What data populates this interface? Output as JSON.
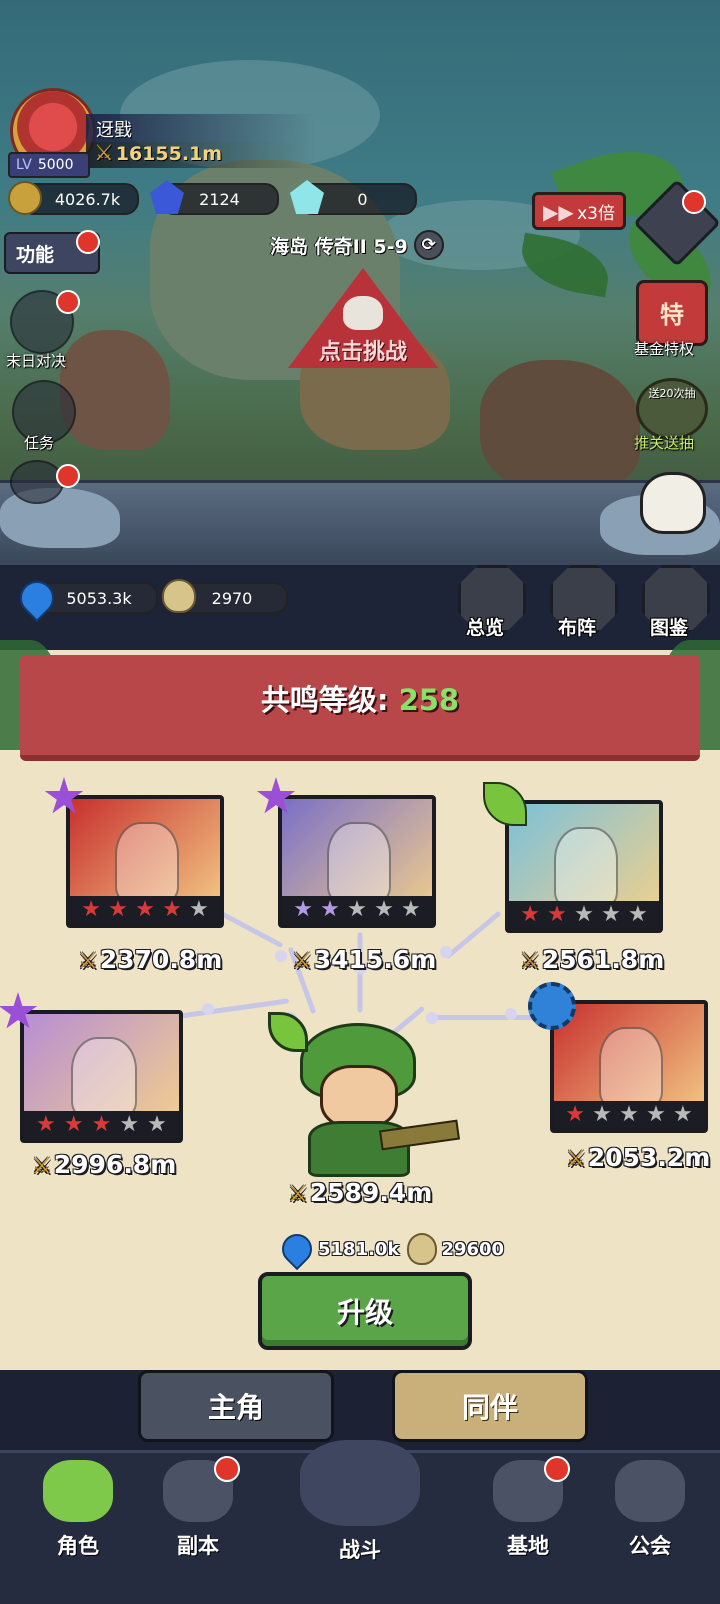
{
  "player": {
    "name": "迓戥",
    "level_label": "LV",
    "level": "5000",
    "power": "16155.1m"
  },
  "currencies": {
    "gold": "4026.7k",
    "blue_gem": "2124",
    "diamond": "0"
  },
  "speed_button": {
    "label": "x3倍"
  },
  "function_button": {
    "label": "功能"
  },
  "stage": {
    "label": "海岛 传奇II 5-9"
  },
  "challenge_button": {
    "label": "点击挑战"
  },
  "left_menu": [
    {
      "label": "末日对决"
    },
    {
      "label": "任务"
    }
  ],
  "right_menu": [
    {
      "label": "基金特权",
      "badge": "特"
    },
    {
      "label": "推关送抽",
      "badge": "送20次抽"
    }
  ],
  "resources": {
    "essence": "5053.3k",
    "seed": "2970"
  },
  "top_buttons": [
    {
      "label": "总览"
    },
    {
      "label": "布阵"
    },
    {
      "label": "图鉴"
    }
  ],
  "resonance": {
    "label": "共鸣等级:",
    "value": "258"
  },
  "heroes": [
    {
      "power": "2370.8m",
      "stars_filled": 4,
      "stars_total": 5,
      "star_color": "#d83a3a",
      "element_icon": "purple-star-icon",
      "card_color": "#c8302e"
    },
    {
      "power": "3415.6m",
      "stars_filled": 2,
      "stars_total": 5,
      "star_color": "#b29ae6",
      "element_icon": "purple-star-icon",
      "card_color": "#7a6fc8"
    },
    {
      "power": "2561.8m",
      "stars_filled": 2,
      "stars_total": 5,
      "star_color": "#d83a3a",
      "element_icon": "green-leaf-icon",
      "card_color": "#7cc0d9"
    },
    {
      "power": "2996.8m",
      "stars_filled": 3,
      "stars_total": 5,
      "star_color": "#d83a3a",
      "element_icon": "purple-star-icon",
      "card_color": "#b78ed4"
    },
    {
      "power": "2053.2m",
      "stars_filled": 1,
      "stars_total": 5,
      "star_color": "#d83a3a",
      "element_icon": "blue-gear-icon",
      "card_color": "#c8302e"
    }
  ],
  "main_hero": {
    "power": "2589.4m",
    "element_icon": "green-leaf-icon"
  },
  "upgrade_cost": {
    "essence": "5181.0k",
    "seed": "29600"
  },
  "upgrade_button": {
    "label": "升级"
  },
  "sub_tabs": [
    {
      "label": "主角"
    },
    {
      "label": "同伴"
    }
  ],
  "nav": [
    {
      "label": "角色",
      "icon": "character-icon",
      "badge": false
    },
    {
      "label": "副本",
      "icon": "cannon-icon",
      "badge": true
    },
    {
      "label": "战斗",
      "icon": "crossed-swords-icon",
      "badge": false
    },
    {
      "label": "基地",
      "icon": "base-icon",
      "badge": true
    },
    {
      "label": "公会",
      "icon": "guild-icon",
      "badge": false
    }
  ],
  "colors": {
    "accent_green": "#5aa548",
    "badge_red": "#e0352b",
    "banner_red": "#b8474a",
    "resonance_value": "#8ce06a"
  }
}
